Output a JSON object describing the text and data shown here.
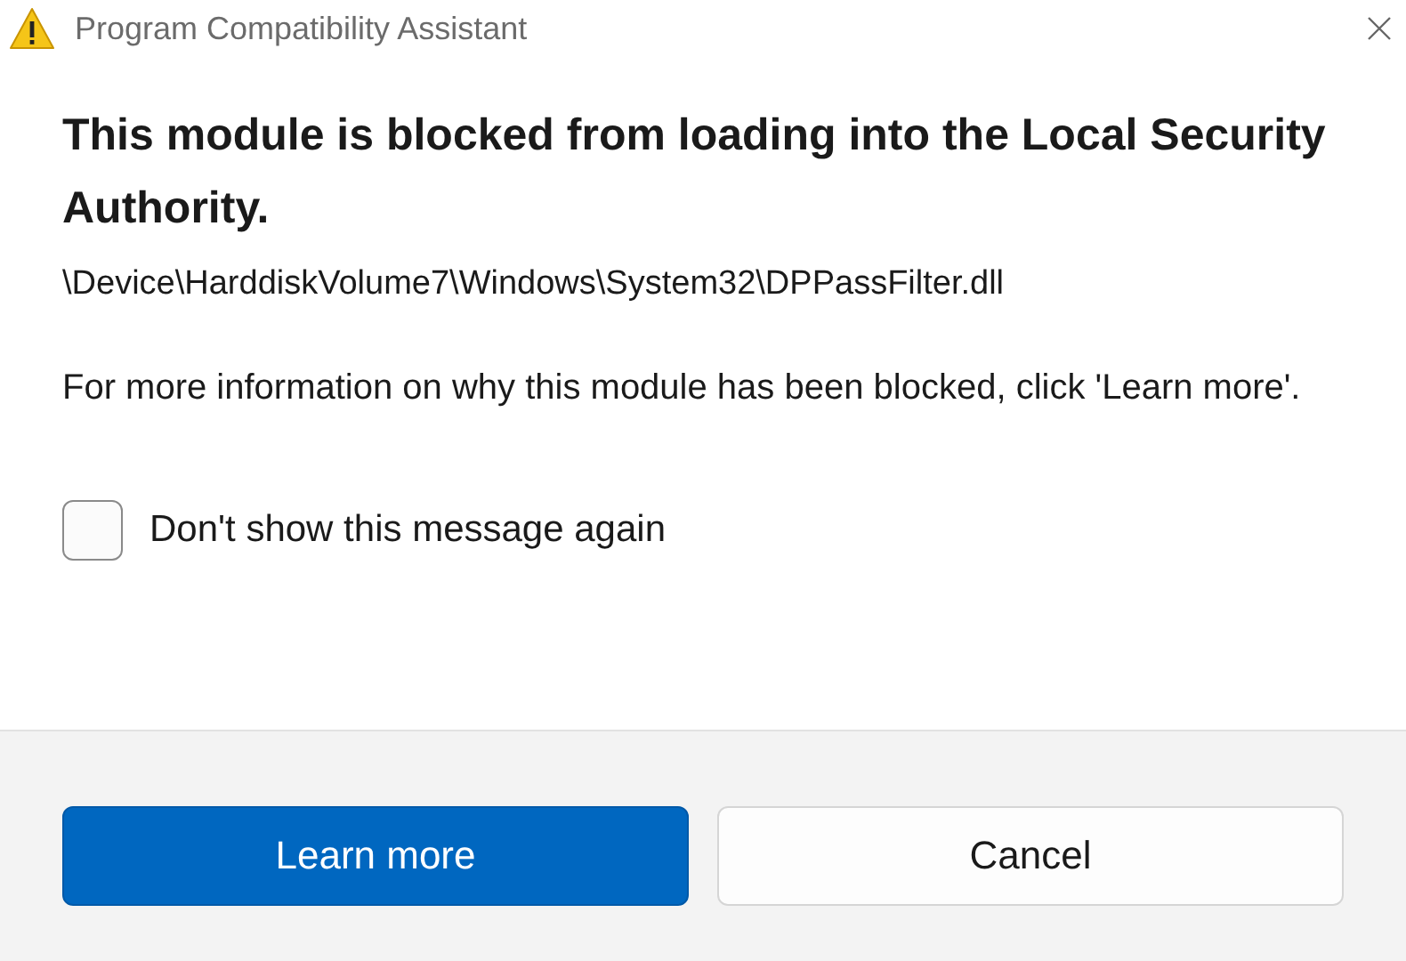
{
  "window": {
    "title": "Program Compatibility Assistant"
  },
  "heading": "This module is blocked from loading into the Local Security Authority.",
  "path": "\\Device\\HarddiskVolume7\\Windows\\System32\\DPPassFilter.dll",
  "message": "For more information on why this module has been blocked, click 'Learn more'.",
  "checkbox": {
    "label": "Don't show this message again",
    "checked": false
  },
  "buttons": [
    {
      "label": "Learn more",
      "kind": "primary"
    },
    {
      "label": "Cancel",
      "kind": "secondary"
    }
  ]
}
